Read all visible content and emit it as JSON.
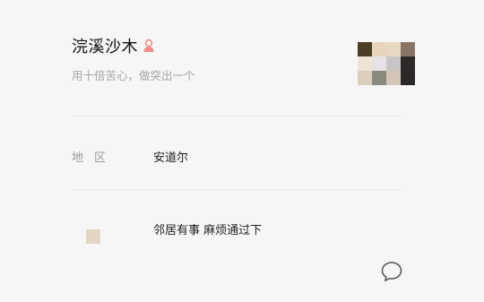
{
  "profile": {
    "nickname": "浣溪沙木",
    "signature": "用十倍苦心，做突出一个",
    "gender_icon": "female-user-icon",
    "avatar_colors": [
      "#4a3f26",
      "#e8d5be",
      "#e9d8c2",
      "#8a7466",
      "#efe5d6",
      "#e6e3e4",
      "#c7c5c6",
      "#2e2929",
      "#dccfbd",
      "#8a8a7f",
      "#d3c5b7",
      "#2b2727"
    ]
  },
  "details": {
    "region_label": "地区",
    "region_value": "安道尔"
  },
  "remark": {
    "text": "邻居有事 麻烦通过下"
  },
  "actions": {
    "chat_icon": "chat-bubble-icon"
  },
  "colors": {
    "background": "#f6f6f6",
    "divider": "#e6e6e6",
    "muted_text": "#9a9a9a",
    "gender_icon": "#f08b8b"
  }
}
